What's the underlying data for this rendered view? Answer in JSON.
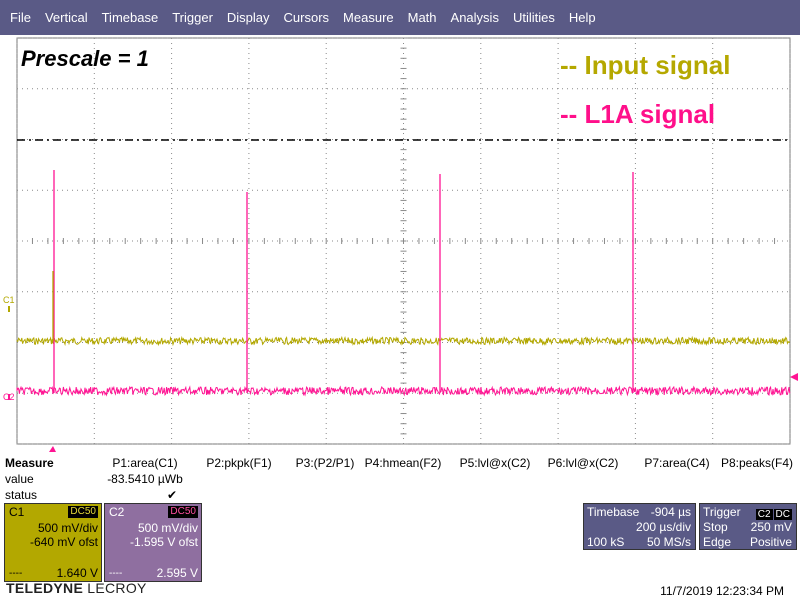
{
  "menu": [
    "File",
    "Vertical",
    "Timebase",
    "Trigger",
    "Display",
    "Cursors",
    "Measure",
    "Math",
    "Analysis",
    "Utilities",
    "Help"
  ],
  "annotations": {
    "prescale": "Prescale = 1",
    "input_signal": "-- Input signal",
    "l1a_signal": "-- L1A signal"
  },
  "colors": {
    "c1": "#b3a800",
    "c2": "#ff1493",
    "menu_bg": "#5a5a86",
    "input_label": "#b5a800",
    "l1a_label": "#ff0f8a"
  },
  "waveform": {
    "c1_marker": "C1",
    "c2_marker": "C2",
    "l1a_pulse_count": 4
  },
  "measure": {
    "title": "Measure",
    "row_value": "value",
    "row_status": "status",
    "params": [
      "P1:area(C1)",
      "P2:pkpk(F1)",
      "P3:(P2/P1)",
      "P4:hmean(F2)",
      "P5:lvl@x(C2)",
      "P6:lvl@x(C2)",
      "P7:area(C4)",
      "P8:peaks(F4)"
    ],
    "p1_value": "-83.5410 µWb",
    "p1_status": "✔"
  },
  "c1": {
    "name": "C1",
    "coupling": "DC50",
    "vdiv": "500 mV/div",
    "offset": "-640 mV ofst",
    "dash": "----",
    "level": "1.640 V"
  },
  "c2": {
    "name": "C2",
    "coupling": "DC50",
    "vdiv": "500 mV/div",
    "offset": "-1.595 V ofst",
    "dash": "----",
    "level": "2.595 V"
  },
  "timebase": {
    "label": "Timebase",
    "delay": "-904 µs",
    "tdiv": "200 µs/div",
    "samples": "100 kS",
    "rate": "50 MS/s"
  },
  "trigger": {
    "label": "Trigger",
    "source": "C2",
    "coupling": "DC",
    "mode": "Stop",
    "level": "250 mV",
    "type": "Edge",
    "slope": "Positive"
  },
  "brand": {
    "name": "TELEDYNE",
    "suffix": "LECROY"
  },
  "datetime": "11/7/2019 12:23:34 PM"
}
